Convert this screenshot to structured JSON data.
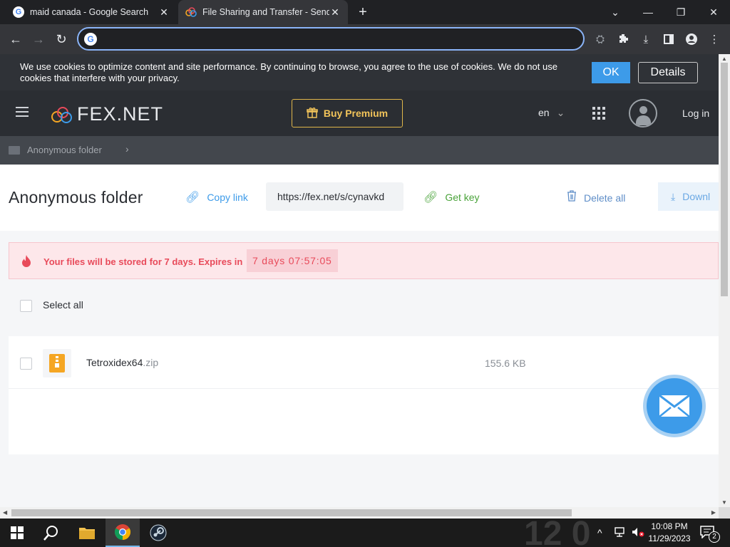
{
  "browser": {
    "tabs": [
      {
        "title": "maid canada - Google Search",
        "favicon": "google-g-icon",
        "active": false
      },
      {
        "title": "File Sharing and Transfer - Send",
        "favicon": "fex-rings-icon",
        "active": true
      }
    ],
    "omnibox_value": "",
    "accent": "#8ab4f8"
  },
  "cookie": {
    "message": "We use cookies to optimize content and site performance. By continuing to browse, you agree to the use of cookies. We do not use cookies that interfere with your privacy.",
    "ok_label": "OK",
    "details_label": "Details"
  },
  "header": {
    "logo_text": "FEX.NET",
    "buy_premium": "Buy Premium",
    "language": "en",
    "login": "Log in"
  },
  "breadcrumb": {
    "label": "Anonymous folder"
  },
  "folder": {
    "title": "Anonymous folder",
    "copy_link": "Copy link",
    "share_url": "https://fex.net/s/cynavkd",
    "get_key": "Get key",
    "delete_all": "Delete all",
    "download": "Downl"
  },
  "expiry": {
    "message": "Your files will be stored for 7 days. Expires in",
    "timer": "7 days  07:57:05",
    "color": "#e84a5a"
  },
  "list": {
    "select_all": "Select all",
    "files": [
      {
        "name": "Tetroxidex64",
        "ext": ".zip",
        "size": "155.6 KB",
        "icon": "zip-file-icon"
      }
    ]
  },
  "taskbar": {
    "time": "10:08 PM",
    "date": "11/29/2023",
    "notifications": "2",
    "apps": [
      "windows-start-icon",
      "search-icon",
      "file-explorer-icon",
      "chrome-icon",
      "steam-icon"
    ]
  }
}
